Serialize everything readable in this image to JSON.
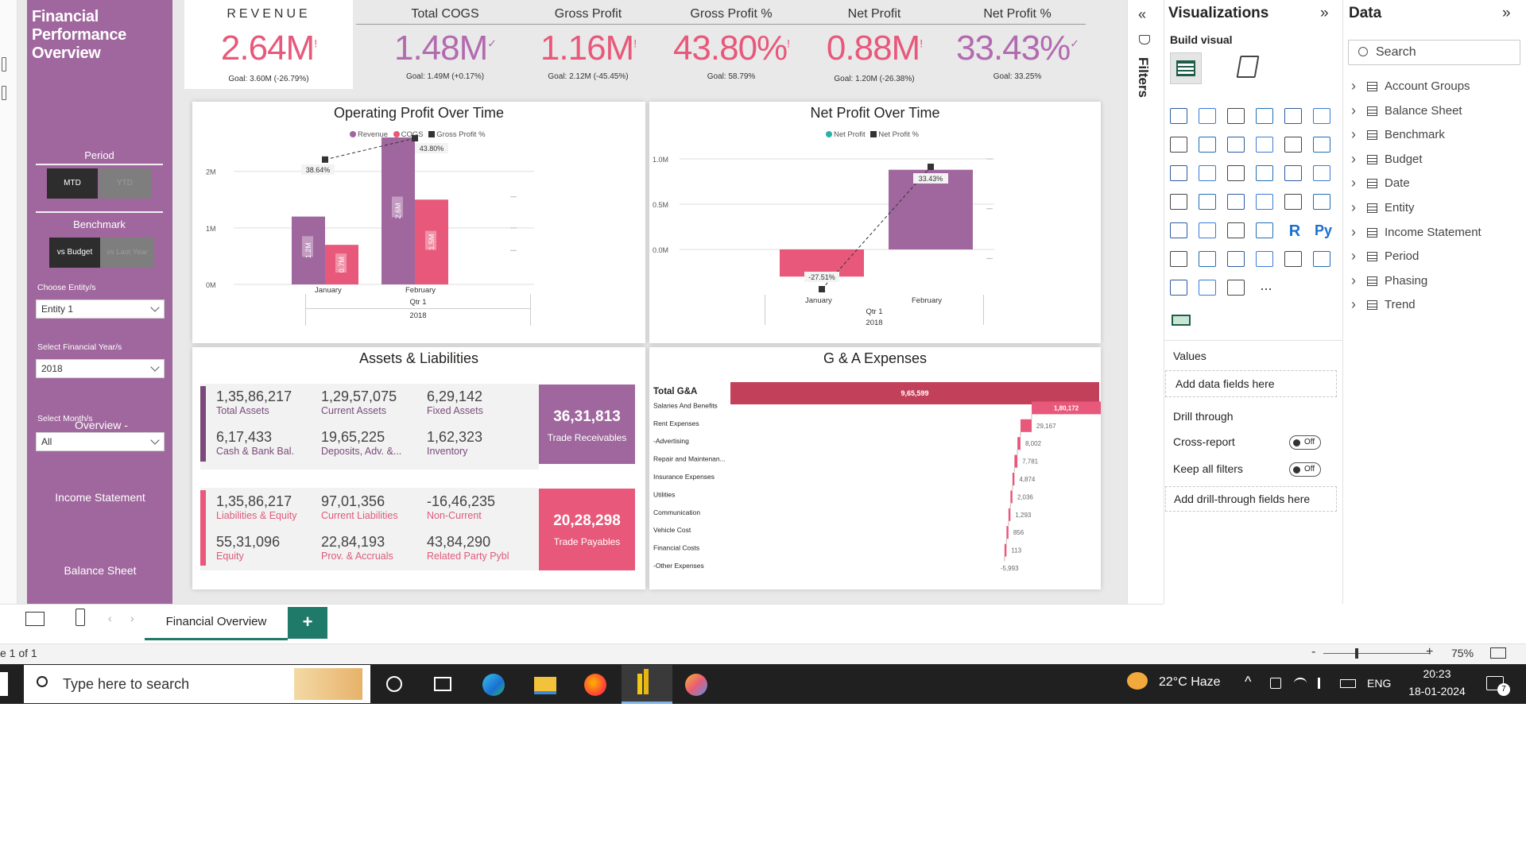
{
  "sidebar": {
    "title_lines": [
      "Financial",
      "Performance",
      "Overview"
    ],
    "period_label": "Period",
    "period_options": [
      "MTD",
      "YTD"
    ],
    "benchmark_label": "Benchmark",
    "benchmark_options": [
      "vs Budget",
      "vs Last Year"
    ],
    "entity_label": "Choose Entity/s",
    "entity_value": "Entity 1",
    "year_label": "Select Financial Year/s",
    "year_value": "2018",
    "month_label": "Select Month/s",
    "month_overlay": "Overview -",
    "month_value": "All",
    "nav_income": "Income Statement",
    "nav_balance": "Balance Sheet"
  },
  "kpis": [
    {
      "title": "REVENUE",
      "value": "2.64M",
      "mark": "!",
      "goal": "Goal: 3.60M (-26.79%)"
    },
    {
      "title": "Total COGS",
      "value": "1.48M",
      "mark": "✓",
      "goal": "Goal: 1.49M (+0.17%)"
    },
    {
      "title": "Gross Profit",
      "value": "1.16M",
      "mark": "!",
      "goal": "Goal: 2.12M (-45.45%)"
    },
    {
      "title": "Gross Profit %",
      "value": "43.80%",
      "mark": "!",
      "goal": "Goal: 58.79%"
    },
    {
      "title": "Net Profit",
      "value": "0.88M",
      "mark": "!",
      "goal": "Goal: 1.20M (-26.38%)"
    },
    {
      "title": "Net Profit %",
      "value": "33.43%",
      "mark": "✓",
      "goal": "Goal: 33.25%"
    }
  ],
  "operating_chart": {
    "title": "Operating Profit Over Time",
    "legend": [
      "Revenue",
      "COGS",
      "Gross Profit %"
    ],
    "y_ticks": [
      "2M",
      "1M",
      "0M"
    ],
    "months": [
      "January",
      "February"
    ],
    "quarter": "Qtr 1",
    "year": "2018"
  },
  "net_chart": {
    "title": "Net Profit Over Time",
    "legend": [
      "Net Profit",
      "Net Profit %"
    ],
    "y_ticks": [
      "1.0M",
      "0.5M",
      "0.0M"
    ],
    "months": [
      "January",
      "February"
    ],
    "quarter": "Qtr 1",
    "year": "2018"
  },
  "chart_data": [
    {
      "type": "bar",
      "title": "Operating Profit Over Time",
      "categories": [
        "January",
        "February"
      ],
      "series": [
        {
          "name": "Revenue",
          "values": [
            1.2,
            2.6
          ],
          "labels": [
            "1.2M",
            "2.6M"
          ]
        },
        {
          "name": "COGS",
          "values": [
            0.7,
            1.5
          ],
          "labels": [
            "0.7M",
            "1.5M"
          ]
        },
        {
          "name": "Gross Profit %",
          "values": [
            38.64,
            43.8
          ],
          "labels": [
            "38.64%",
            "43.80%"
          ],
          "kind": "line"
        }
      ],
      "ylim": [
        0,
        2.6
      ],
      "color_revenue": "#a0679e",
      "color_cogs": "#e8587a",
      "color_gp": "#333333"
    },
    {
      "type": "bar",
      "title": "Net Profit Over Time",
      "categories": [
        "January",
        "February"
      ],
      "series": [
        {
          "name": "Net Profit",
          "values": [
            -0.3,
            0.88
          ]
        },
        {
          "name": "Net Profit %",
          "values": [
            -27.51,
            33.43
          ],
          "labels": [
            "-27.51%",
            "33.43%"
          ],
          "kind": "line"
        }
      ],
      "ylim": [
        -0.3,
        1.0
      ],
      "color_pos": "#a0679e",
      "color_neg": "#e8587a",
      "color_np": "#2ab2a6"
    },
    {
      "type": "bar",
      "title": "G & A Expenses",
      "categories": [
        "Total G&A",
        "Salaries And Benefits",
        "Rent Expenses",
        "-Advertising",
        "Repair and Maintenan...",
        "Insurance Expenses",
        "Utilities",
        "Communication",
        "Vehicle Cost",
        "Financial Costs",
        "-Other Expenses"
      ],
      "values": [
        965599,
        180172,
        29167,
        8002,
        7781,
        4874,
        2036,
        1293,
        856,
        113,
        -5993
      ],
      "labels": [
        "9,65,599",
        "1,80,172",
        "29,167",
        "8,002",
        "7,781",
        "4,874",
        "2,036",
        "1,293",
        "856",
        "113",
        "-5,993"
      ]
    }
  ],
  "assets": {
    "title": "Assets & Liabilities",
    "asset_items": [
      {
        "value": "1,35,86,217",
        "label": "Total Assets"
      },
      {
        "value": "1,29,57,075",
        "label": "Current Assets"
      },
      {
        "value": "6,29,142",
        "label": "Fixed Assets"
      },
      {
        "value": "6,17,433",
        "label": "Cash & Bank Bal."
      },
      {
        "value": "19,65,225",
        "label": "Deposits, Adv. &..."
      },
      {
        "value": "1,62,323",
        "label": "Inventory"
      }
    ],
    "receivables": {
      "value": "36,31,813",
      "label": "Trade Receivables"
    },
    "liability_items": [
      {
        "value": "1,35,86,217",
        "label": "Liabilities & Equity"
      },
      {
        "value": "97,01,356",
        "label": "Current Liabilities"
      },
      {
        "value": "-16,46,235",
        "label": "Non-Current"
      },
      {
        "value": "55,31,096",
        "label": "Equity"
      },
      {
        "value": "22,84,193",
        "label": "Prov. & Accruals"
      },
      {
        "value": "43,84,290",
        "label": "Related Party Pybl"
      }
    ],
    "payables": {
      "value": "20,28,298",
      "label": "Trade Payables"
    }
  },
  "ga": {
    "title": "G & A Expenses"
  },
  "filters_label": "Filters",
  "viz_pane": {
    "title": "Visualizations",
    "build_visual": "Build visual",
    "values_label": "Values",
    "add_data": "Add data fields here",
    "drill_through": "Drill through",
    "cross_report": "Cross-report",
    "keep_filters": "Keep all filters",
    "toggle_off": "Off",
    "add_drill": "Add drill-through fields here",
    "r_label": "R",
    "py_label": "Py",
    "more": "..."
  },
  "data_pane": {
    "title": "Data",
    "search_placeholder": "Search",
    "tables": [
      "Account Groups",
      "Balance Sheet",
      "Benchmark",
      "Budget",
      "Date",
      "Entity",
      "Income Statement",
      "Period",
      "Phasing",
      "Trend"
    ]
  },
  "page_tabs": {
    "active": "Financial Overview",
    "add": "+"
  },
  "status": {
    "page": "e 1 of 1",
    "zoom": "75%",
    "minus": "-",
    "plus": "+"
  },
  "taskbar": {
    "search_placeholder": "Type here to search",
    "weather": "22°C  Haze",
    "lang": "ENG",
    "time": "20:23",
    "date": "18-01-2024",
    "notif_count": "7"
  },
  "colors": {
    "accent": "#a0679e",
    "pink": "#e8587a",
    "dark": "#2d2d2d",
    "teal": "#2ab2a6"
  }
}
